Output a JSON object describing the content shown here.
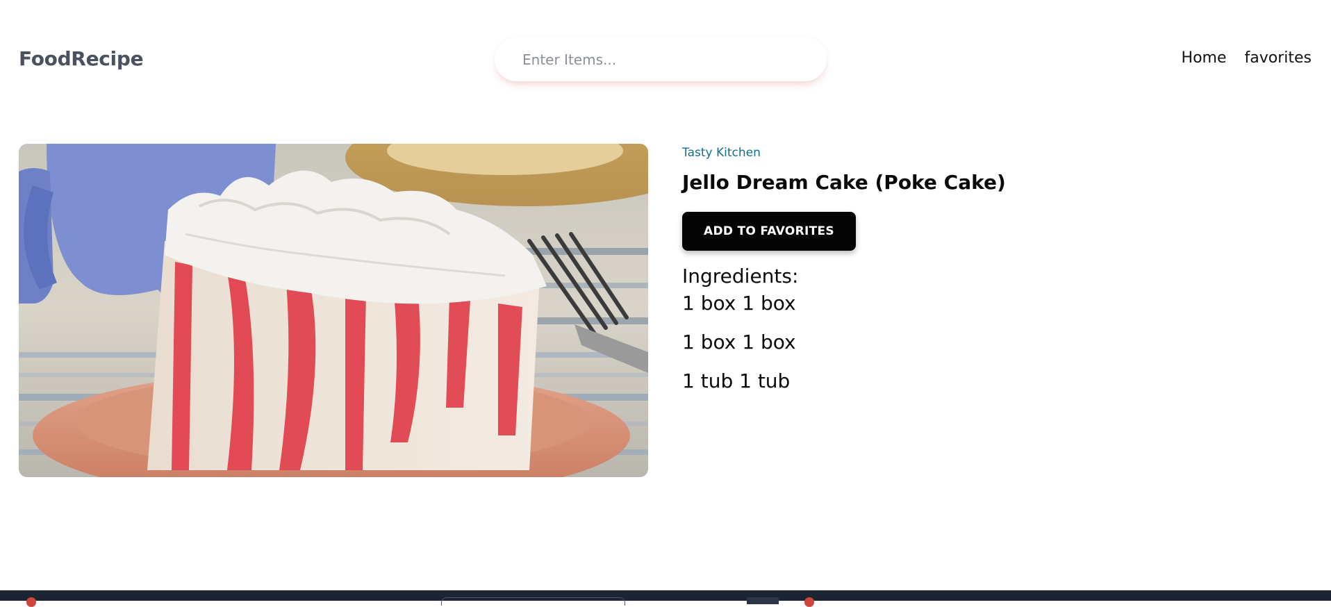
{
  "header": {
    "brand": "FoodRecipe",
    "search": {
      "placeholder": "Enter Items...",
      "value": ""
    },
    "nav": [
      {
        "label": "Home"
      },
      {
        "label": "favorites"
      }
    ]
  },
  "recipe": {
    "image_icon": "cake-photo",
    "publisher": "Tasty Kitchen",
    "title": "Jello Dream Cake (Poke Cake)",
    "favorite_button": "ADD TO FAVORITES",
    "ingredients_heading": "Ingredients:",
    "ingredients": [
      {
        "text": "1 box 1 box"
      },
      {
        "text": "1 box 1 box"
      },
      {
        "text": "1 tub 1 tub"
      }
    ]
  },
  "colors": {
    "brand": "#4a5260",
    "publisher": "#0f6f8a",
    "button_bg": "#050505",
    "taskbar": "#1b2433"
  }
}
